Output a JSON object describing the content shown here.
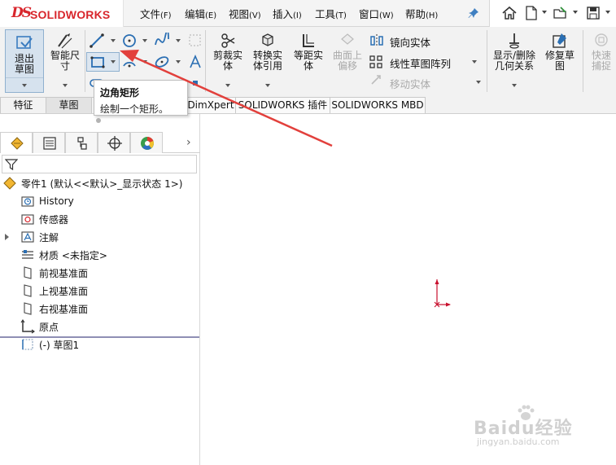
{
  "app": {
    "logo_ds": "DS",
    "logo_name": "SOLIDWORKS"
  },
  "menu": [
    {
      "label": "文件",
      "key": "(F)"
    },
    {
      "label": "编辑",
      "key": "(E)"
    },
    {
      "label": "视图",
      "key": "(V)"
    },
    {
      "label": "插入",
      "key": "(I)"
    },
    {
      "label": "工具",
      "key": "(T)"
    },
    {
      "label": "窗口",
      "key": "(W)"
    },
    {
      "label": "帮助",
      "key": "(H)"
    }
  ],
  "quick_access": {
    "icons": [
      "home-icon",
      "new-document-icon",
      "open-icon",
      "save-icon"
    ]
  },
  "commands": {
    "exit_sketch": "退出草图",
    "smart_dimension": "智能尺寸",
    "trim": "剪裁实体",
    "convert": "转换实体引用",
    "offset": "等距实体",
    "offset_surface": "曲面上偏移",
    "mirror": "镜向实体",
    "linear_pattern": "线性草图阵列",
    "move": "移动实体",
    "display_relations": "显示/删除几何关系",
    "repair": "修复草图",
    "quick_snap": "快速捕捉"
  },
  "tabs": [
    "特征",
    "草图",
    "",
    "DimXpert",
    "SOLIDWORKS 插件",
    "SOLIDWORKS MBD"
  ],
  "tooltip": {
    "title": "边角矩形",
    "description": "绘制一个矩形。"
  },
  "feature_tree": {
    "part": "零件1 (默认<<默认>_显示状态 1>)",
    "items": [
      {
        "label": "History",
        "icon": "history-folder-icon"
      },
      {
        "label": "传感器",
        "icon": "sensor-icon"
      },
      {
        "label": "注解",
        "icon": "annotation-icon"
      },
      {
        "label": "材质 <未指定>",
        "icon": "material-icon"
      },
      {
        "label": "前视基准面",
        "icon": "plane-icon"
      },
      {
        "label": "上视基准面",
        "icon": "plane-icon"
      },
      {
        "label": "右视基准面",
        "icon": "plane-icon"
      },
      {
        "label": "原点",
        "icon": "origin-icon"
      },
      {
        "label": "(-) 草图1",
        "icon": "sketch-icon"
      }
    ]
  },
  "watermark": {
    "brand": "Baidu经验",
    "url": "jingyan.baidu.com"
  },
  "colors": {
    "brand_red": "#d8262c",
    "active_blue": "#d6e2ee",
    "annotation_arrow": "#e2403c",
    "origin_red": "#c8102e"
  }
}
